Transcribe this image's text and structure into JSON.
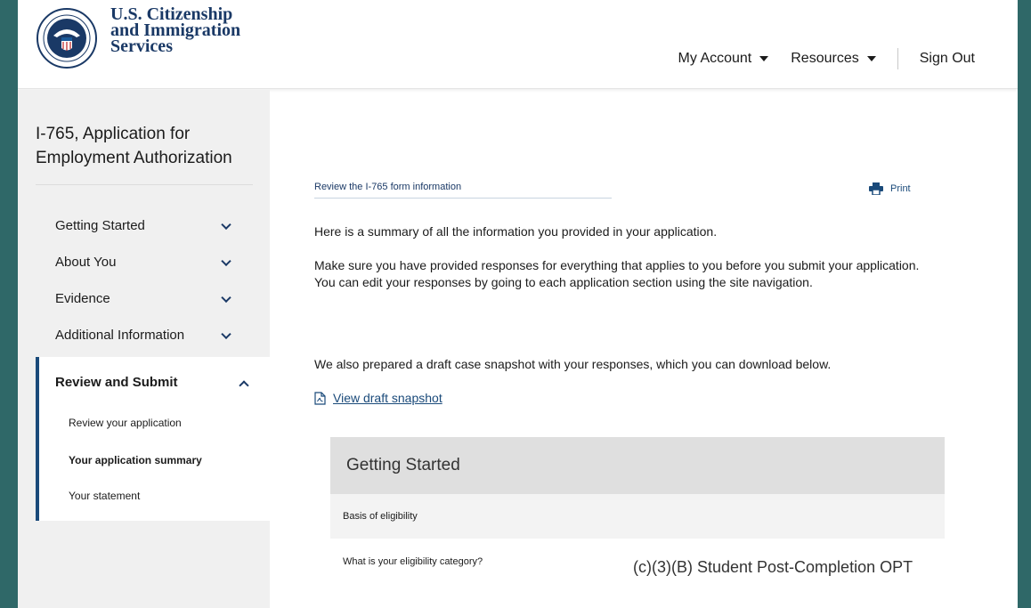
{
  "header": {
    "logo_line1": "U.S. Citizenship",
    "logo_line2": "and Immigration",
    "logo_line3": "Services",
    "nav": {
      "my_account": "My Account",
      "resources": "Resources",
      "sign_out": "Sign Out"
    }
  },
  "sidebar": {
    "form_title": "I-765, Application for Employment Authorization",
    "items": [
      {
        "label": "Getting Started"
      },
      {
        "label": "About You"
      },
      {
        "label": "Evidence"
      },
      {
        "label": "Additional Information"
      }
    ],
    "active_section": {
      "label": "Review and Submit",
      "sub_items": [
        {
          "label": "Review your application"
        },
        {
          "label": "Your application summary"
        },
        {
          "label": "Your statement"
        }
      ]
    }
  },
  "main": {
    "review_link": "Review the I-765 form information",
    "print_label": "Print",
    "summary_intro": "Here is a summary of all the information you provided in your application.",
    "make_sure": "Make sure you have provided responses for everything that applies to you before you submit your application. You can edit your responses by going to each application section using the site navigation.",
    "draft_note": "We also prepared a draft case snapshot with your responses, which you can download below.",
    "view_draft": "View draft snapshot",
    "section_title": "Getting Started",
    "subsection_label": "Basis of eligibility",
    "question": "What is your eligibility category?",
    "answer": "(c)(3)(B) Student Post-Completion OPT"
  },
  "colors": {
    "background_frame": "#2f6868",
    "brand_navy": "#1a3966",
    "link_blue": "#1a4a7a",
    "sidebar_bg": "#f0f0f0",
    "section_header_bg": "#dfdfdf"
  },
  "icons": [
    "dhs-seal-icon",
    "caret-down-icon",
    "chevron-down-icon",
    "chevron-up-icon",
    "printer-icon",
    "pdf-file-icon"
  ]
}
